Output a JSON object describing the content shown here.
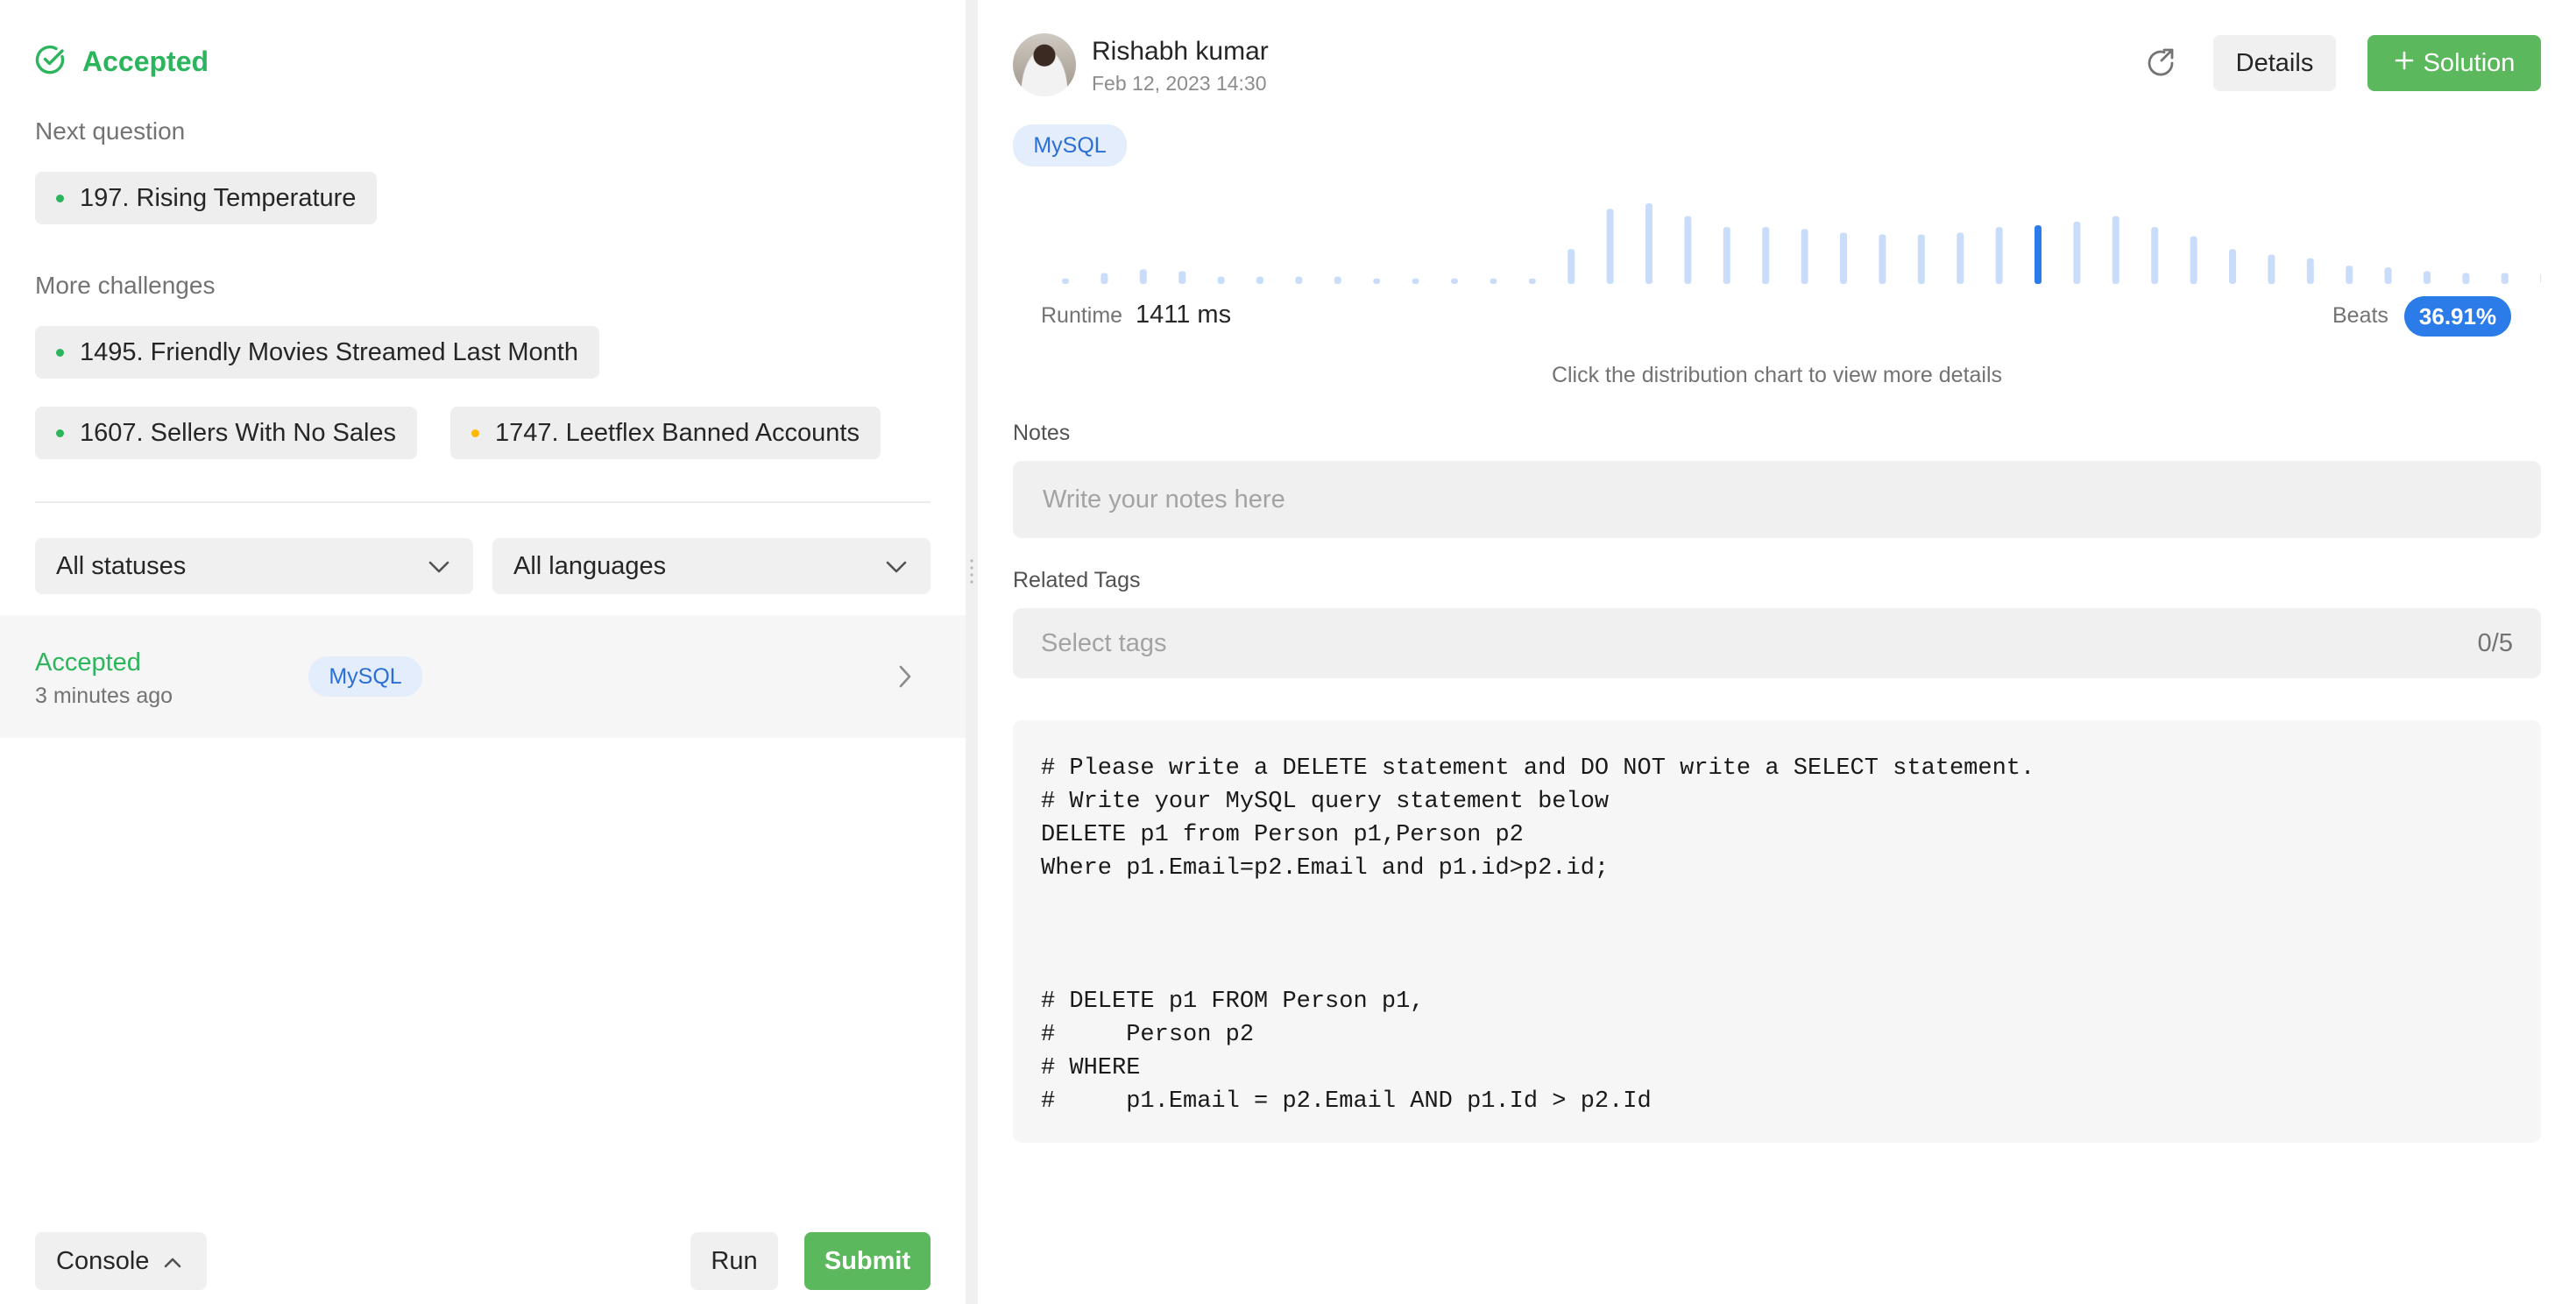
{
  "left": {
    "status_title": "Accepted",
    "next_label": "Next question",
    "next_question": {
      "title": "197. Rising Temperature",
      "difficulty": "easy"
    },
    "more_label": "More challenges",
    "challenges": [
      {
        "title": "1495. Friendly Movies Streamed Last Month",
        "difficulty": "easy"
      },
      {
        "title": "1607. Sellers With No Sales",
        "difficulty": "easy"
      },
      {
        "title": "1747. Leetflex Banned Accounts",
        "difficulty": "medium"
      }
    ],
    "filters": {
      "status": "All statuses",
      "language": "All languages"
    },
    "submission": {
      "status": "Accepted",
      "time": "3 minutes ago",
      "language": "MySQL"
    },
    "footer": {
      "console": "Console",
      "run": "Run",
      "submit": "Submit"
    }
  },
  "right": {
    "author": "Rishabh kumar",
    "date": "Feb 12, 2023 14:30",
    "buttons": {
      "details": "Details",
      "solution": "Solution"
    },
    "language": "MySQL",
    "runtime_label": "Runtime",
    "runtime_value": "1411 ms",
    "beats_label": "Beats",
    "beats_value": "36.91%",
    "hint": "Click the distribution chart to view more details",
    "notes_label": "Notes",
    "notes_placeholder": "Write your notes here",
    "tags_label": "Related Tags",
    "tags_placeholder": "Select tags",
    "tags_count": "0/5",
    "code": "# Please write a DELETE statement and DO NOT write a SELECT statement.\n# Write your MySQL query statement below\nDELETE p1 from Person p1,Person p2\nWhere p1.Email=p2.Email and p1.id>p2.id;\n\n\n\n# DELETE p1 FROM Person p1,\n#     Person p2\n# WHERE\n#     p1.Email = p2.Email AND p1.Id > p2.Id"
  },
  "colors": {
    "accent_green": "#2db55d",
    "button_green": "#5cb85c",
    "accent_blue": "#2b7ce9",
    "bar_light": "#c9ddfb",
    "bar_highlight": "#2b7ce9"
  },
  "distribution": {
    "values": [
      3,
      6,
      8,
      7,
      4,
      4,
      4,
      4,
      3,
      3,
      3,
      3,
      3,
      19,
      41,
      44,
      37,
      31,
      31,
      30,
      28,
      27,
      27,
      28,
      31,
      32,
      34,
      37,
      31,
      26,
      19,
      16,
      14,
      10,
      9,
      7,
      6,
      6,
      6
    ],
    "highlight_index": 25,
    "max": 44
  }
}
